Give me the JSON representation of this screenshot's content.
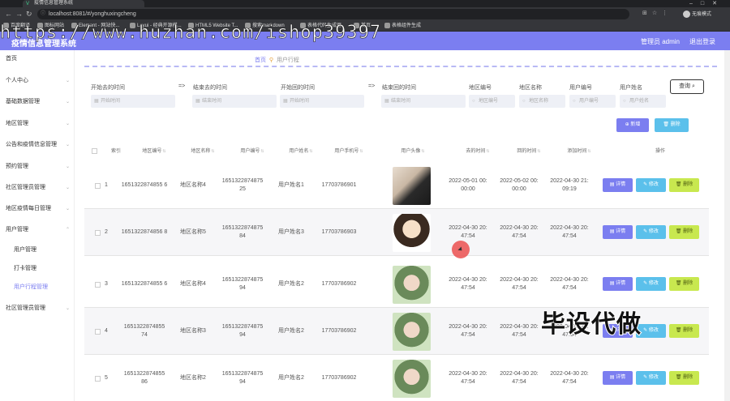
{
  "browser": {
    "tab_title": "疫情信息管理系统",
    "url": "localhost:8081/#/yonghuxingcheng",
    "bookmarks": [
      "百度翻译",
      "图标网站",
      "Element - 网站快...",
      "Layui - 经典开源模...",
      "HTML5 Website T...",
      "搜索markdown",
      "表格代码生成器",
      "首页",
      "表格组件生成",
      "无痕模式"
    ],
    "profile": "无痕模式"
  },
  "watermark": "https://www.huzhan.com/ishop39397",
  "header": {
    "title": "疫情信息管理系统",
    "admin": "管理员 admin",
    "logout": "退出登录"
  },
  "sidebar": {
    "items": [
      {
        "label": "首页"
      },
      {
        "label": "个人中心"
      },
      {
        "label": "基础数据管理"
      },
      {
        "label": "地区管理"
      },
      {
        "label": "公告和疫情信息管理"
      },
      {
        "label": "预约管理"
      },
      {
        "label": "社区管理员管理"
      },
      {
        "label": "地区疫情每日管理"
      },
      {
        "label": "用户管理"
      },
      {
        "label": "用户管理"
      },
      {
        "label": "打卡管理"
      },
      {
        "label": "用户行程管理"
      },
      {
        "label": "社区管理员管理"
      }
    ]
  },
  "breadcrumb": {
    "home": "首页",
    "current": "用户行程"
  },
  "filters": {
    "labels": [
      "开始去的时间",
      "=>",
      "结束去的时间",
      "开始回的时间",
      "=>",
      "结束回的时间",
      "地区编号",
      "地区名称",
      "用户编号",
      "用户姓名"
    ],
    "placeholders": [
      "开始时间",
      "结束时间",
      "开始时间",
      "结束时间",
      "地区编号",
      "地区名称",
      "用户编号",
      "用户姓名"
    ],
    "search": "查询"
  },
  "toolbar": {
    "add": "新增",
    "delete": "删除"
  },
  "table": {
    "headers": [
      "索引",
      "地区编号",
      "地区名称",
      "用户编号",
      "用户姓名",
      "用户手机号",
      "用户头像",
      "去的时间",
      "回的时间",
      "添加时间",
      "操作"
    ],
    "rows": [
      {
        "idx": "1",
        "area_code": "1651322874855 6",
        "area_name": "地区名称4",
        "user_code": "1651322874875 25",
        "user_name": "用户姓名1",
        "phone": "17703786901",
        "go_time": "2022-05-01 00: 00:00",
        "back_time": "2022-05-02 00: 00:00",
        "add_time": "2022-04-30 21: 09:19"
      },
      {
        "idx": "2",
        "area_code": "1651322874856 8",
        "area_name": "地区名称5",
        "user_code": "1651322874875 84",
        "user_name": "用户姓名3",
        "phone": "17703786903",
        "go_time": "2022-04-30 20: 47:54",
        "back_time": "2022-04-30 20: 47:54",
        "add_time": "2022-04-30 20: 47:54"
      },
      {
        "idx": "3",
        "area_code": "1651322874855 6",
        "area_name": "地区名称4",
        "user_code": "1651322874875 94",
        "user_name": "用户姓名2",
        "phone": "17703786902",
        "go_time": "2022-04-30 20: 47:54",
        "back_time": "2022-04-30 20: 47:54",
        "add_time": "2022-04-30 20: 47:54"
      },
      {
        "idx": "4",
        "area_code": "1651322874855 74",
        "area_name": "地区名称3",
        "user_code": "1651322874875 94",
        "user_name": "用户姓名2",
        "phone": "17703786902",
        "go_time": "2022-04-30 20: 47:54",
        "back_time": "2022-04-30 20: 47:54",
        "add_time": "2022-04-30 20: 47:54"
      },
      {
        "idx": "5",
        "area_code": "1651322874855 86",
        "area_name": "地区名称2",
        "user_code": "1651322874875 94",
        "user_name": "用户姓名2",
        "phone": "17703786902",
        "go_time": "2022-04-30 20: 47:54",
        "back_time": "2022-04-30 20: 47:54",
        "add_time": "2022-04-30 20: 47:54"
      }
    ],
    "actions": {
      "detail": "详情",
      "edit": "修改",
      "delete": "删除"
    }
  },
  "overlay_text": "毕设代做",
  "colors": {
    "primary": "#7b7ef0",
    "info": "#5bc0eb",
    "success": "#c8e84f"
  }
}
